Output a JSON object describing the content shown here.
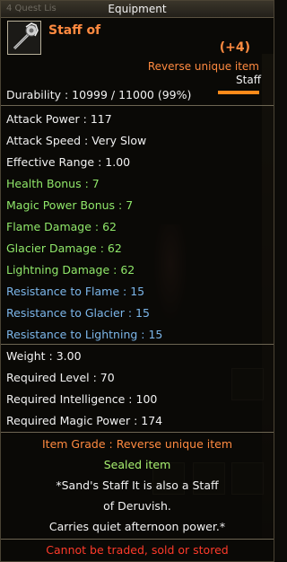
{
  "window": {
    "title": "Equipment",
    "ghost_label": "4 Quest Lis"
  },
  "item": {
    "icon": "staff-icon",
    "name": "Staff of",
    "upgrade": "(+4)",
    "grade_tag": "Reverse unique item",
    "type": "Staff",
    "durability_text": "Durability : 10999 / 11000 (99%)",
    "durability_fraction": 0.99
  },
  "stats": {
    "attack_power": "Attack Power : 117",
    "attack_speed": "Attack Speed : Very Slow",
    "effective_range": "Effective Range : 1.00",
    "health_bonus": "Health Bonus : 7",
    "magic_power_bonus": "Magic Power Bonus : 7",
    "flame_damage": "Flame Damage : 62",
    "glacier_damage": "Glacier Damage : 62",
    "lightning_damage": "Lightning Damage : 62",
    "res_flame": "Resistance to Flame : 15",
    "res_glacier": "Resistance to Glacier : 15",
    "res_lightning": "Resistance to Lightning : 15"
  },
  "requirements": {
    "weight": "Weight : 3.00",
    "level": "Required Level : 70",
    "intelligence": "Required Intelligence : 100",
    "magic_power": "Required Magic Power : 174"
  },
  "footer": {
    "item_grade": "Item Grade : Reverse unique item",
    "sealed": "Sealed item",
    "desc1": "*Sand's Staff It is also a Staff",
    "desc2": "of Deruvish.",
    "desc3": "Carries quiet afternoon power.*",
    "trade": "Cannot be traded, sold or stored"
  },
  "colors": {
    "unique_orange": "#ff8a40",
    "bonus_green": "#90e86a",
    "resistance_blue": "#7cb6ea",
    "warning_red": "#ff3a2a"
  }
}
